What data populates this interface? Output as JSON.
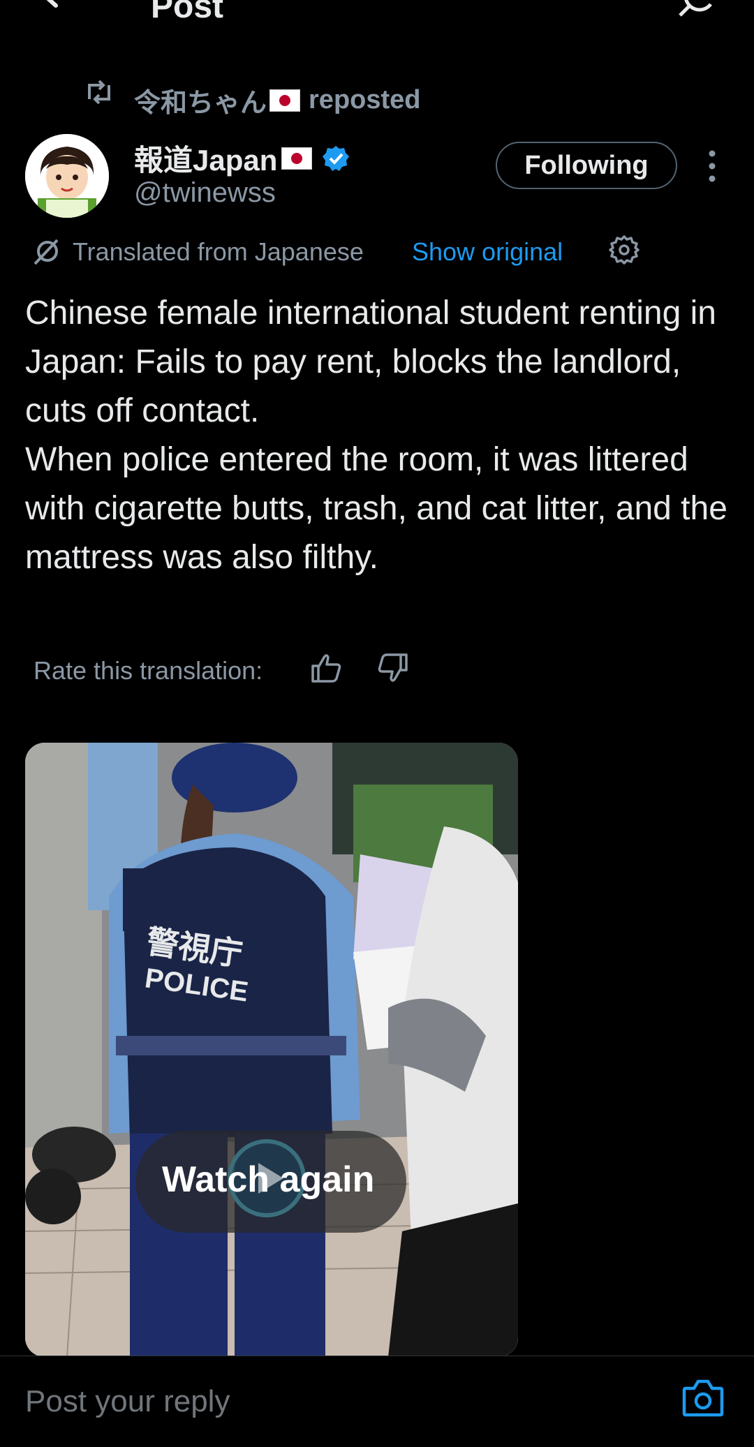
{
  "header": {
    "title": "Post"
  },
  "repost": {
    "by": "令和ちゃん",
    "suffix": "reposted"
  },
  "author": {
    "name": "報道Japan",
    "handle": "@twinewss",
    "follow_label": "Following"
  },
  "translation": {
    "label": "Translated from Japanese",
    "show_original": "Show original",
    "rate_label": "Rate this translation:"
  },
  "post": {
    "text": "Chinese female international student renting in Japan: Fails to pay rent, blocks the landlord, cuts off contact.\nWhen police entered the room, it was littered with cigarette butts, trash, and cat litter, and the mattress was also filthy."
  },
  "media": {
    "overlay_label": "Watch again",
    "vest_text": "POLICE",
    "vest_kanji": "警視庁"
  },
  "reply": {
    "placeholder": "Post your reply"
  },
  "colors": {
    "background": "#000000",
    "accent": "#1d9bf0",
    "text": "#e7e9ea",
    "secondary": "#8b98a5"
  },
  "icons": [
    "back-arrow-icon",
    "refresh-icon",
    "repost-icon",
    "verified-icon",
    "more-icon",
    "translate-icon",
    "settings-icon",
    "thumbs-up-icon",
    "thumbs-down-icon",
    "play-icon",
    "camera-icon"
  ]
}
